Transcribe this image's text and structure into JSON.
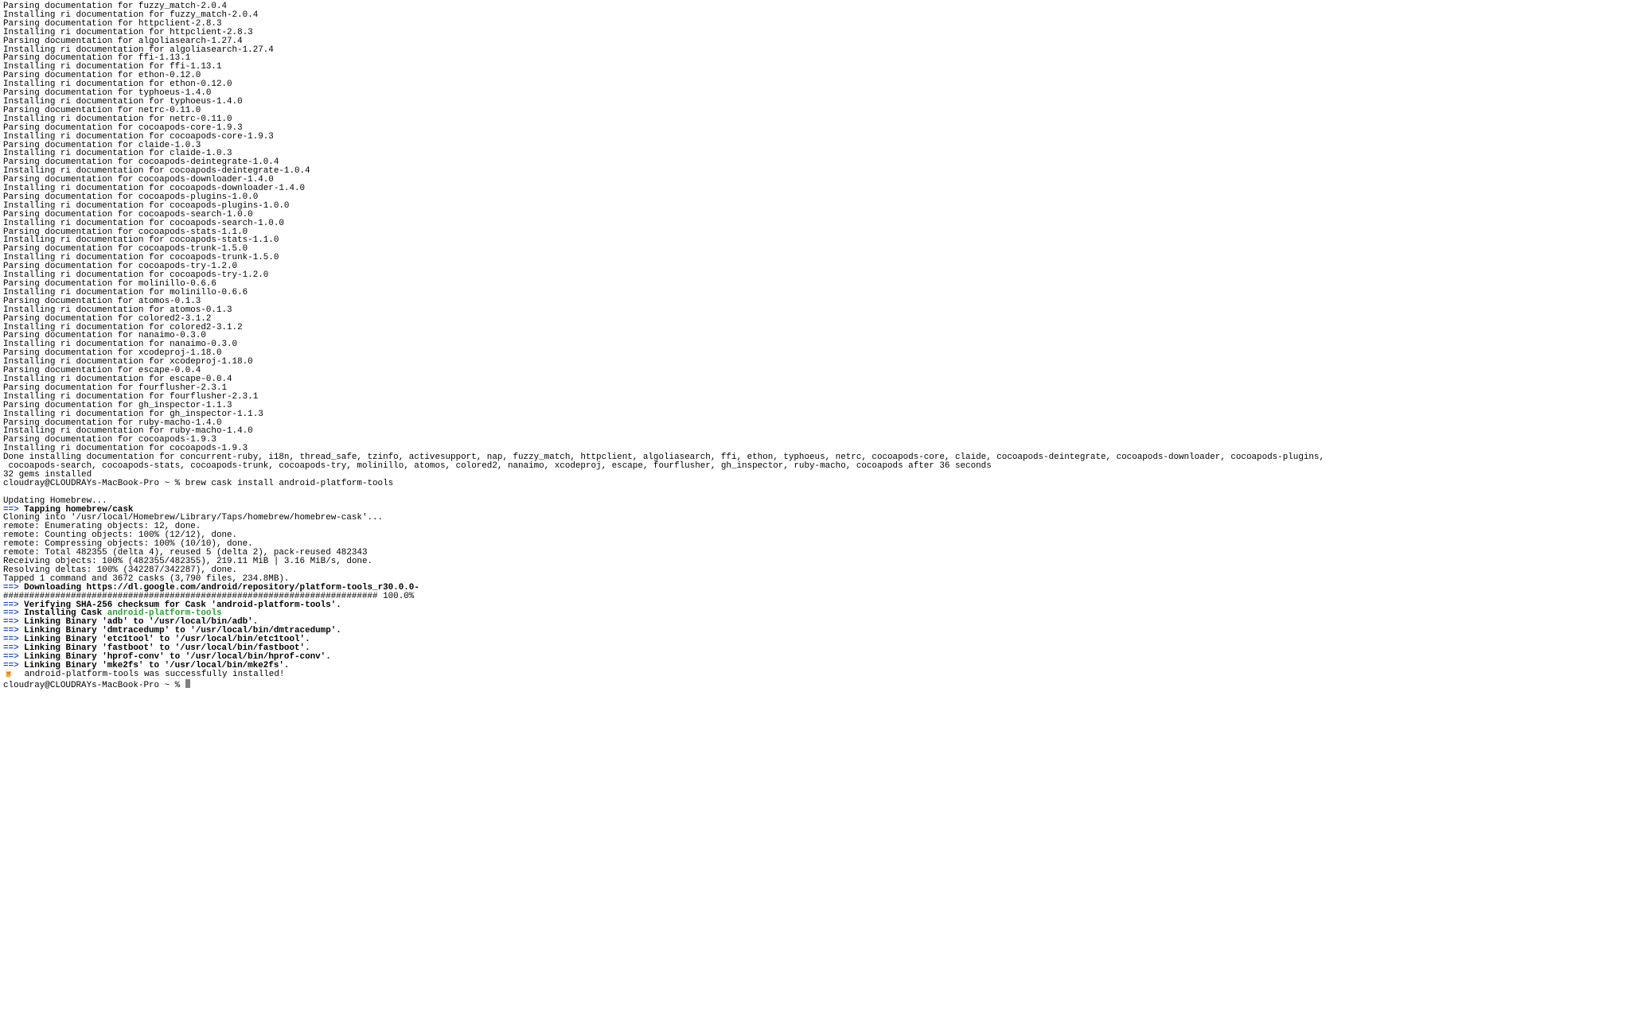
{
  "plain_lines": [
    "Parsing documentation for fuzzy_match-2.0.4",
    "Installing ri documentation for fuzzy_match-2.0.4",
    "Parsing documentation for httpclient-2.8.3",
    "Installing ri documentation for httpclient-2.8.3",
    "Parsing documentation for algoliasearch-1.27.4",
    "Installing ri documentation for algoliasearch-1.27.4",
    "Parsing documentation for ffi-1.13.1",
    "Installing ri documentation for ffi-1.13.1",
    "Parsing documentation for ethon-0.12.0",
    "Installing ri documentation for ethon-0.12.0",
    "Parsing documentation for typhoeus-1.4.0",
    "Installing ri documentation for typhoeus-1.4.0",
    "Parsing documentation for netrc-0.11.0",
    "Installing ri documentation for netrc-0.11.0",
    "Parsing documentation for cocoapods-core-1.9.3",
    "Installing ri documentation for cocoapods-core-1.9.3",
    "Parsing documentation for claide-1.0.3",
    "Installing ri documentation for claide-1.0.3",
    "Parsing documentation for cocoapods-deintegrate-1.0.4",
    "Installing ri documentation for cocoapods-deintegrate-1.0.4",
    "Parsing documentation for cocoapods-downloader-1.4.0",
    "Installing ri documentation for cocoapods-downloader-1.4.0",
    "Parsing documentation for cocoapods-plugins-1.0.0",
    "Installing ri documentation for cocoapods-plugins-1.0.0",
    "Parsing documentation for cocoapods-search-1.0.0",
    "Installing ri documentation for cocoapods-search-1.0.0",
    "Parsing documentation for cocoapods-stats-1.1.0",
    "Installing ri documentation for cocoapods-stats-1.1.0",
    "Parsing documentation for cocoapods-trunk-1.5.0",
    "Installing ri documentation for cocoapods-trunk-1.5.0",
    "Parsing documentation for cocoapods-try-1.2.0",
    "Installing ri documentation for cocoapods-try-1.2.0",
    "Parsing documentation for molinillo-0.6.6",
    "Installing ri documentation for molinillo-0.6.6",
    "Parsing documentation for atomos-0.1.3",
    "Installing ri documentation for atomos-0.1.3",
    "Parsing documentation for colored2-3.1.2",
    "Installing ri documentation for colored2-3.1.2",
    "Parsing documentation for nanaimo-0.3.0",
    "Installing ri documentation for nanaimo-0.3.0",
    "Parsing documentation for xcodeproj-1.18.0",
    "Installing ri documentation for xcodeproj-1.18.0",
    "Parsing documentation for escape-0.0.4",
    "Installing ri documentation for escape-0.0.4",
    "Parsing documentation for fourflusher-2.3.1",
    "Installing ri documentation for fourflusher-2.3.1",
    "Parsing documentation for gh_inspector-1.1.3",
    "Installing ri documentation for gh_inspector-1.1.3",
    "Parsing documentation for ruby-macho-1.4.0",
    "Installing ri documentation for ruby-macho-1.4.0",
    "Parsing documentation for cocoapods-1.9.3",
    "Installing ri documentation for cocoapods-1.9.3",
    "Done installing documentation for concurrent-ruby, i18n, thread_safe, tzinfo, activesupport, nap, fuzzy_match, httpclient, algoliasearch, ffi, ethon, typhoeus, netrc, cocoapods-core, claide, cocoapods-deintegrate, cocoapods-downloader, cocoapods-plugins,",
    " cocoapods-search, cocoapods-stats, cocoapods-trunk, cocoapods-try, molinillo, atomos, colored2, nanaimo, xcodeproj, escape, fourflusher, gh_inspector, ruby-macho, cocoapods after 36 seconds",
    "32 gems installed"
  ],
  "prompt1": "cloudray@CLOUDRAYs-MacBook-Pro ~ % brew cask install android-platform-tools",
  "blank1": "",
  "updating": "Updating Homebrew...",
  "arrow": "==>",
  "tapping": "Tapping homebrew/cask",
  "clone_lines": [
    "Cloning into '/usr/local/Homebrew/Library/Taps/homebrew/homebrew-cask'...",
    "remote: Enumerating objects: 12, done.",
    "remote: Counting objects: 100% (12/12), done.",
    "remote: Compressing objects: 100% (10/10), done.",
    "remote: Total 482355 (delta 4), reused 5 (delta 2), pack-reused 482343",
    "Receiving objects: 100% (482355/482355), 219.11 MiB | 3.16 MiB/s, done.",
    "Resolving deltas: 100% (342287/342287), done.",
    "Tapped 1 command and 3672 casks (3,790 files, 234.8MB)."
  ],
  "downloading": "Downloading https://dl.google.com/android/repository/platform-tools_r30.0.0-",
  "progress": "######################################################################## 100.0%",
  "verifying": "Verifying SHA-256 checksum for Cask 'android-platform-tools'.",
  "installing_cask": "Installing Cask ",
  "cask_name": "android-platform-tools",
  "link1": "Linking Binary 'adb' to '/usr/local/bin/adb'.",
  "link2": "Linking Binary 'dmtracedump' to '/usr/local/bin/dmtracedump'.",
  "link3": "Linking Binary 'etc1tool' to '/usr/local/bin/etc1tool'.",
  "link4": "Linking Binary 'fastboot' to '/usr/local/bin/fastboot'.",
  "link5": "Linking Binary 'hprof-conv' to '/usr/local/bin/hprof-conv'.",
  "link6": "Linking Binary 'mke2fs' to '/usr/local/bin/mke2fs'.",
  "beer_icon": "🍺",
  "success_msg": "  android-platform-tools was successfully installed!",
  "prompt2": "cloudray@CLOUDRAYs-MacBook-Pro ~ % "
}
